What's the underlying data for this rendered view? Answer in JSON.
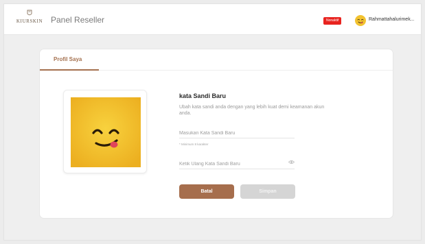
{
  "header": {
    "logo_text": "KIURSKIN",
    "title": "Panel Reseller",
    "status_badge": "Nonaktif",
    "user_name": "Rahmattahalurimek..."
  },
  "tabs": [
    {
      "label": "Profil Saya",
      "active": true
    }
  ],
  "password_form": {
    "heading": "kata Sandi Baru",
    "description": "Ubah kata sandi anda dengan yang lebih kuat demi keamanan akun anda.",
    "new_password_placeholder": "Masukan Kata Sandi Baru",
    "hint": "* Minimum 8 karakter",
    "confirm_password_placeholder": "Ketik Ulang Kata Sandi Baru",
    "cancel_label": "Batal",
    "save_label": "Simpan"
  },
  "icons": {
    "logo": "kiurskin-logo-icon",
    "avatar": "smiley-avatar",
    "eye": "eye-icon"
  },
  "colors": {
    "accent": "#a66e4d",
    "badge": "#e8231f",
    "avatar_bg": "#f4c534",
    "disabled": "#d5d5d5"
  }
}
